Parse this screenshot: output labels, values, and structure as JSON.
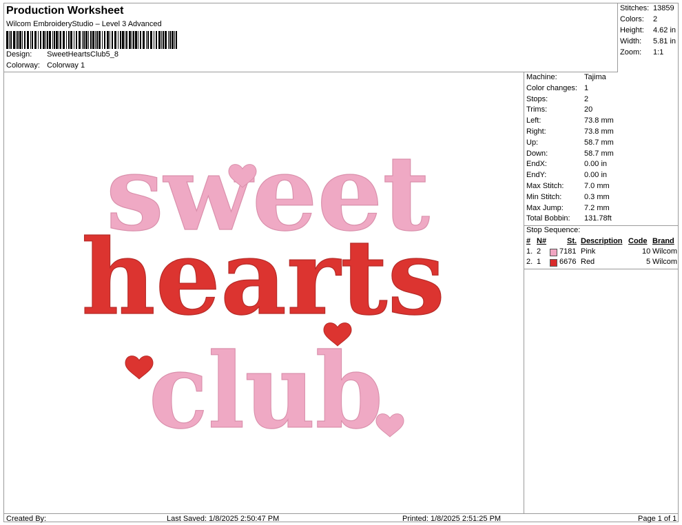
{
  "header": {
    "title": "Production Worksheet",
    "software": "Wilcom EmbroideryStudio – Level 3 Advanced",
    "design_label": "Design:",
    "design_value": "SweetHeartsClub5_8",
    "colorway_label": "Colorway:",
    "colorway_value": "Colorway 1"
  },
  "top_stats": {
    "stitches_label": "Stitches:",
    "stitches_value": "13859",
    "colors_label": "Colors:",
    "colors_value": "2",
    "height_label": "Height:",
    "height_value": "4.62 in",
    "width_label": "Width:",
    "width_value": "5.81 in",
    "zoom_label": "Zoom:",
    "zoom_value": "1:1"
  },
  "machine_info": [
    {
      "label": "Machine:",
      "value": "Tajima"
    },
    {
      "label": "Color changes:",
      "value": "1"
    },
    {
      "label": "Stops:",
      "value": "2"
    },
    {
      "label": "Trims:",
      "value": "20"
    },
    {
      "label": "Left:",
      "value": "73.8 mm"
    },
    {
      "label": "Right:",
      "value": "73.8 mm"
    },
    {
      "label": "Up:",
      "value": "58.7 mm"
    },
    {
      "label": "Down:",
      "value": "58.7 mm"
    },
    {
      "label": "EndX:",
      "value": "0.00 in"
    },
    {
      "label": "EndY:",
      "value": "0.00 in"
    },
    {
      "label": "Max Stitch:",
      "value": "7.0 mm"
    },
    {
      "label": "Min Stitch:",
      "value": "0.3 mm"
    },
    {
      "label": "Max Jump:",
      "value": "7.2 mm"
    },
    {
      "label": "Total Bobbin:",
      "value": "131.78ft"
    }
  ],
  "stop_sequence": {
    "label": "Stop Sequence:",
    "headers": {
      "num": "#",
      "n": "N#",
      "st": "St.",
      "desc": "Description",
      "code": "Code",
      "brand": "Brand"
    },
    "rows": [
      {
        "num": "1.",
        "n": "2",
        "color": "#f0a6c2",
        "st": "7181",
        "desc": "Pink",
        "code": "10",
        "brand": "Wilcom"
      },
      {
        "num": "2.",
        "n": "1",
        "color": "#d92b2b",
        "st": "6676",
        "desc": "Red",
        "code": "5",
        "brand": "Wilcom"
      }
    ]
  },
  "design": {
    "line1": "sweet",
    "line2": "hearts",
    "line3": "club",
    "pink": "#efa9c4",
    "red": "#dc3430"
  },
  "footer": {
    "created_by": "Created By:",
    "last_saved": "Last Saved: 1/8/2025 2:50:47 PM",
    "printed": "Printed: 1/8/2025 2:51:25 PM",
    "page": "Page 1 of 1"
  }
}
